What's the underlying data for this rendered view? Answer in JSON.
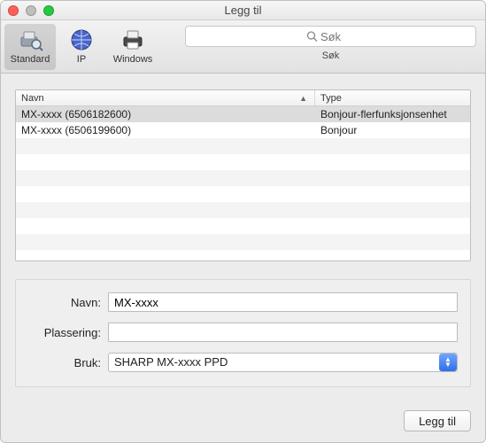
{
  "window": {
    "title": "Legg til"
  },
  "toolbar": {
    "items": [
      {
        "label": "Standard",
        "icon": "printer-search-icon",
        "selected": true
      },
      {
        "label": "IP",
        "icon": "globe-icon",
        "selected": false
      },
      {
        "label": "Windows",
        "icon": "printer-icon",
        "selected": false
      }
    ],
    "search": {
      "placeholder": "Søk",
      "label": "Søk"
    }
  },
  "list": {
    "columns": {
      "name": "Navn",
      "type": "Type"
    },
    "sort": {
      "column": "name",
      "dir": "asc"
    },
    "rows": [
      {
        "name": "MX-xxxx (6506182600)",
        "type": "Bonjour-flerfunksjonsenhet",
        "selected": true
      },
      {
        "name": "MX-xxxx (6506199600)",
        "type": "Bonjour",
        "selected": false
      }
    ]
  },
  "form": {
    "name_label": "Navn:",
    "name_value": "MX-xxxx",
    "location_label": "Plassering:",
    "location_value": "",
    "use_label": "Bruk:",
    "use_value": "SHARP MX-xxxx PPD"
  },
  "footer": {
    "add_label": "Legg til"
  }
}
